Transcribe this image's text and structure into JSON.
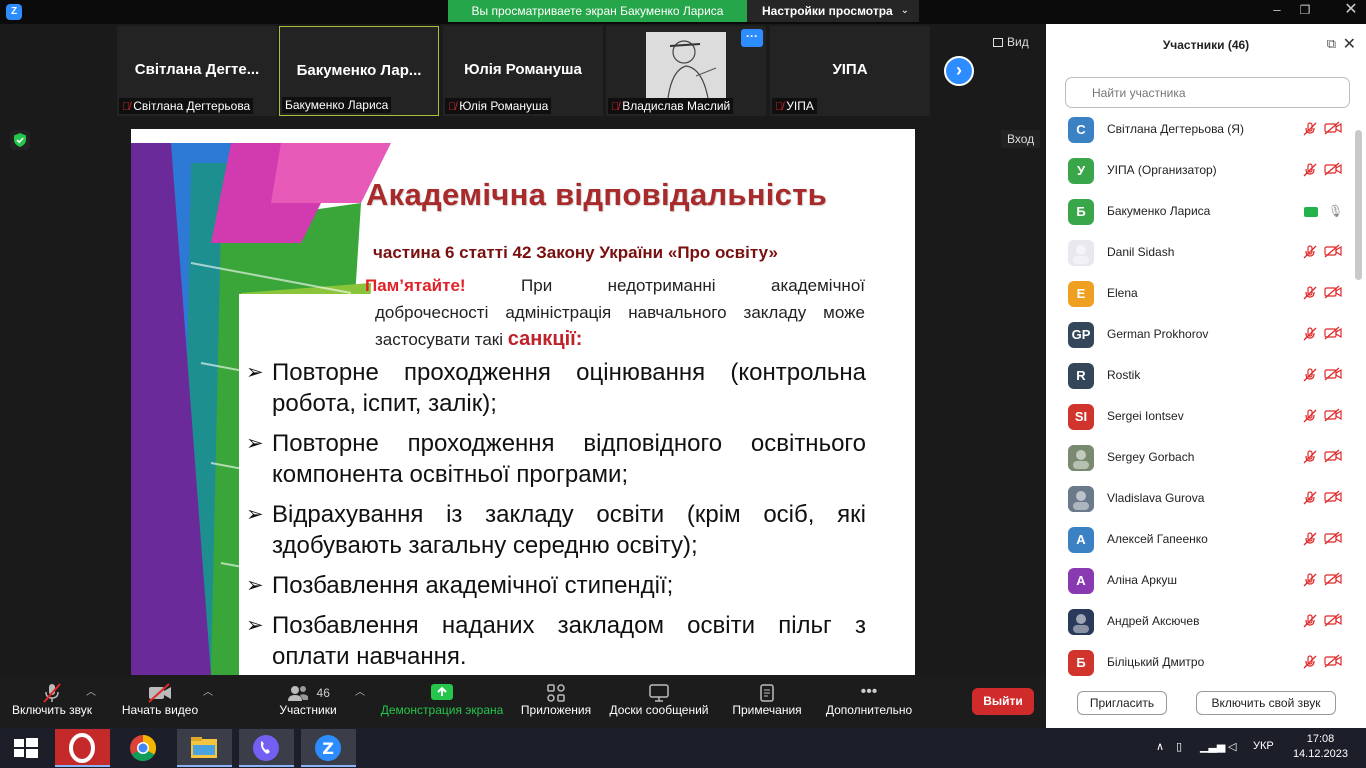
{
  "window": {
    "share_banner": "Вы просматриваете экран Бакуменко Лариса",
    "view_settings": "Настройки просмотра",
    "minimize": "–",
    "maximize": "❐",
    "close": "✕"
  },
  "thumbnails": [
    {
      "title": "Світлана Дегте...",
      "name": "Світлана Дегтерьова",
      "muted": true
    },
    {
      "title": "Бакуменко Лар...",
      "name": "Бакуменко Лариса",
      "muted": false,
      "active": true
    },
    {
      "title": "Юлія Романуша",
      "name": "Юлія Романуша",
      "muted": true
    },
    {
      "title": "",
      "name": "Владислав Маслий",
      "muted": true,
      "has_image": true
    },
    {
      "title": "УІПА",
      "name": "УІПА",
      "muted": true
    }
  ],
  "view_button": "Вид",
  "exit_fullscreen": "Вход",
  "slide": {
    "title": "Академічна відповідальність",
    "subtitle": "частина 6 статті 42 Закону України «Про освіту»",
    "intro_remember": "Пам’ятайте!",
    "intro_line1_words": [
      "При",
      "недотриманні",
      "академічної"
    ],
    "intro_line2_words": [
      "доброчесності",
      "адміністрація",
      "навчального",
      "закладу",
      "може"
    ],
    "intro_line3": "застосувати такі",
    "intro_sanctions": "санкції:",
    "bullets": [
      "Повторне проходження оцінювання (контрольна робота, іспит, залік);",
      "Повторне проходження відповідного освітнього компонента освітньої програми;",
      "Відрахування із закладу освіти (крім осіб, які здобувають загальну середню освіту);",
      "Позбавлення академічної стипендії;",
      "Позбавлення наданих закладом освіти пільг з оплати навчання."
    ]
  },
  "toolbar": {
    "mute": "Включить звук",
    "video": "Начать видео",
    "participants": "Участники",
    "participants_count": "46",
    "share": "Демонстрация экрана",
    "apps": "Приложения",
    "whiteboards": "Доски сообщений",
    "notes": "Примечания",
    "more": "Дополнительно",
    "leave": "Выйти"
  },
  "panel": {
    "title": "Участники (46)",
    "search_placeholder": "Найти участника",
    "participants": [
      {
        "initials": "С",
        "name": "Світлана Дегтерьова (Я)",
        "color": "#3a82c4",
        "state": "muted"
      },
      {
        "initials": "У",
        "name": "УІПА (Организатор)",
        "color": "#3aa64a",
        "state": "muted"
      },
      {
        "initials": "Б",
        "name": "Бакуменко Лариса",
        "color": "#3aa64a",
        "state": "sharing"
      },
      {
        "initials": "",
        "name": "Danil Sidash",
        "color": "#e8e8ee",
        "state": "muted",
        "photo": true
      },
      {
        "initials": "E",
        "name": "Elena",
        "color": "#f0a020",
        "state": "muted"
      },
      {
        "initials": "GP",
        "name": "German Prokhorov",
        "color": "#34465a",
        "state": "muted"
      },
      {
        "initials": "R",
        "name": "Rostik",
        "color": "#34465a",
        "state": "muted"
      },
      {
        "initials": "SI",
        "name": "Sergei Iontsev",
        "color": "#d0342c",
        "state": "muted"
      },
      {
        "initials": "",
        "name": "Sergey Gorbach",
        "color": "#7a8a70",
        "state": "muted",
        "photo": true
      },
      {
        "initials": "",
        "name": "Vladislava Gurova",
        "color": "#6a7a8a",
        "state": "muted",
        "photo": true
      },
      {
        "initials": "А",
        "name": "Алексей Гапеенко",
        "color": "#3a82c4",
        "state": "muted"
      },
      {
        "initials": "А",
        "name": "Аліна Аркуш",
        "color": "#8a3ab0",
        "state": "muted"
      },
      {
        "initials": "",
        "name": "Андрей Аксючев",
        "color": "#2a3a5a",
        "state": "muted",
        "photo": true
      },
      {
        "initials": "Б",
        "name": "Біліцький Дмитро",
        "color": "#d0342c",
        "state": "muted"
      }
    ],
    "invite": "Пригласить",
    "unmute_self": "Включить свой звук"
  },
  "taskbar": {
    "lang": "УКР",
    "time": "17:08",
    "date": "14.12.2023"
  }
}
